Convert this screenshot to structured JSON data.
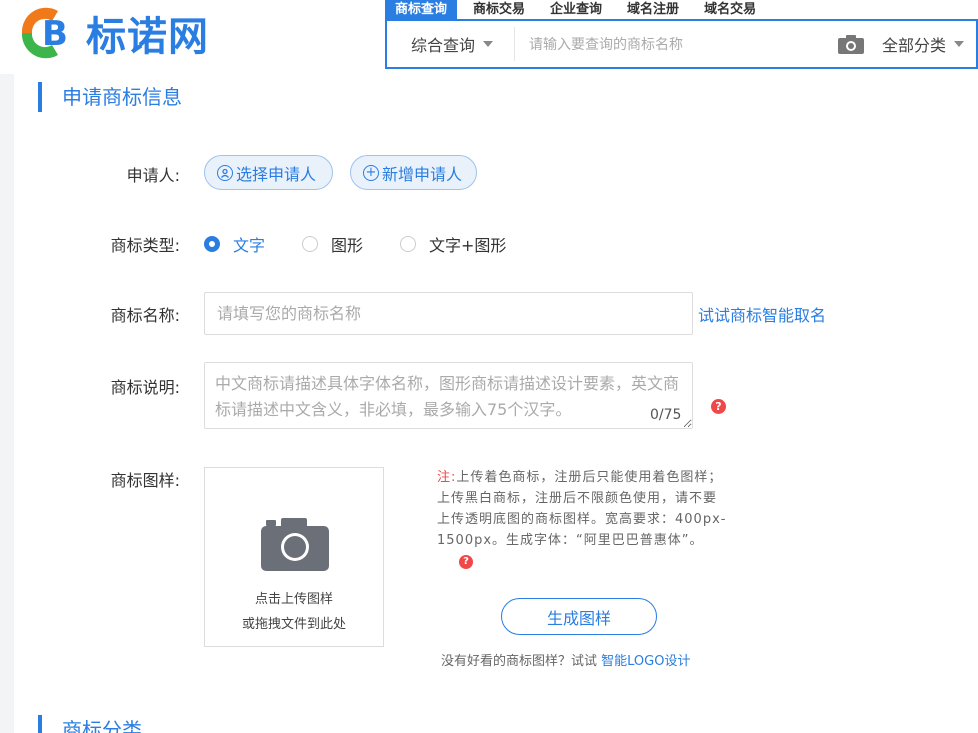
{
  "header": {
    "logo_text": "标诺网",
    "search_tabs": [
      "商标查询",
      "商标交易",
      "企业查询",
      "域名注册",
      "域名交易"
    ],
    "search_type": "综合查询",
    "search_placeholder": "请输入要查询的商标名称",
    "search_category": "全部分类",
    "accent_color": "#2a7de1"
  },
  "form": {
    "section_title": "申请商标信息",
    "applicant": {
      "label": "申请人:",
      "select_button": "选择申请人",
      "add_button": "新增申请人"
    },
    "type": {
      "label": "商标类型:",
      "options": [
        "文字",
        "图形",
        "文字+图形"
      ],
      "selected": "文字"
    },
    "name": {
      "label": "商标名称:",
      "placeholder": "请填写您的商标名称",
      "link": "试试商标智能取名"
    },
    "description": {
      "label": "商标说明:",
      "placeholder": "中文商标请描述具体字体名称，图形商标请描述设计要素，英文商标请描述中文含义，非必填，最多输入75个汉字。",
      "counter": "0/75"
    },
    "sample": {
      "label": "商标图样:",
      "upload_line1": "点击上传图样",
      "upload_line2": "或拖拽文件到此处",
      "note_prefix": "注:",
      "note_body": "上传着色商标，注册后只能使用着色图样；上传黑白商标，注册后不限颜色使用，请不要上传透明底图的商标图样。宽高要求：400px-1500px。生成字体：“阿里巴巴普惠体”。",
      "generate_button": "生成图样",
      "tip_text": "没有好看的商标图样？试试",
      "tip_link": "智能LOGO设计"
    },
    "next_section_title": "商标分类"
  }
}
